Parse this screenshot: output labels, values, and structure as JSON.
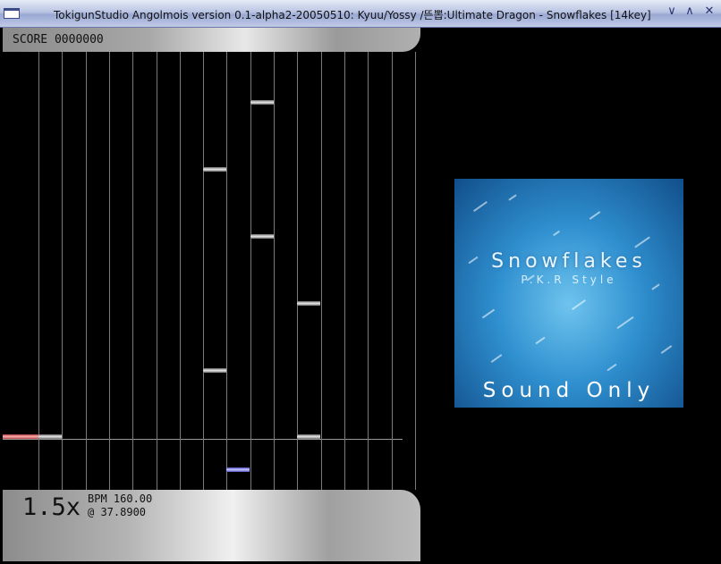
{
  "window": {
    "title": "TokigunStudio Angolmois version 0.1-alpha2-20050510: Kyuu/Yossy /뜬뽑:Ultimate Dragon - Snowflakes [14key]",
    "controls": [
      "minimize-icon",
      "maximize-icon",
      "close-icon"
    ]
  },
  "score": {
    "label": "SCORE 0000000"
  },
  "playfield": {
    "lanes": 17,
    "notes": [
      {
        "lane": 10,
        "row": 1,
        "color": "gray"
      },
      {
        "lane": 8,
        "row": 2,
        "color": "gray"
      },
      {
        "lane": 10,
        "row": 3,
        "color": "gray"
      },
      {
        "lane": 12,
        "row": 4,
        "color": "gray"
      },
      {
        "lane": 8,
        "row": 5,
        "color": "gray"
      },
      {
        "lane": 0,
        "row": 6,
        "color": "red"
      },
      {
        "lane": 1,
        "row": 6,
        "color": "gray"
      },
      {
        "lane": 12,
        "row": 6,
        "color": "gray"
      },
      {
        "lane": 9,
        "row": 7,
        "color": "blue"
      }
    ]
  },
  "status": {
    "speed": "1.5x",
    "bpm": "BPM 160.00",
    "position": "@ 37.8900"
  },
  "album": {
    "title": "Snowflakes",
    "subtitle": "P.K.R Style",
    "caption": "Sound Only"
  },
  "colors": {
    "background": "#000000",
    "lane_line": "#7a7a7a",
    "note_gray": "#d0d0d0",
    "note_red": "#ff9090",
    "note_blue": "#b0b0ff",
    "album_blue": "#2f8fcf"
  }
}
